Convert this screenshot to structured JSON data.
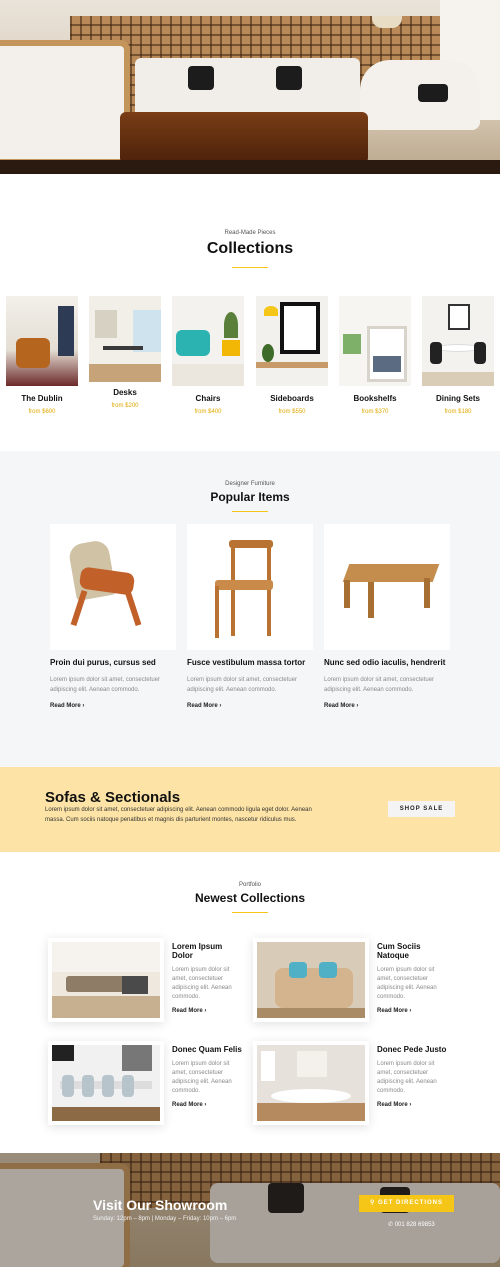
{
  "collections": {
    "eyebrow": "Read-Made Pieces",
    "title": "Collections",
    "items": [
      {
        "name": "The Dublin",
        "price": "from $600"
      },
      {
        "name": "Desks",
        "price": "from $200"
      },
      {
        "name": "Chairs",
        "price": "from $400"
      },
      {
        "name": "Sideboards",
        "price": "from $550"
      },
      {
        "name": "Bookshelfs",
        "price": "from $370"
      },
      {
        "name": "Dining Sets",
        "price": "from $180"
      }
    ]
  },
  "popular": {
    "eyebrow": "Designer Furniture",
    "title": "Popular Items",
    "items": [
      {
        "title": "Proin dui purus, cursus sed",
        "desc": "Lorem ipsum dolor sit amet, consectetuer adipiscing elit. Aenean commodo.",
        "more": "Read More ›"
      },
      {
        "title": "Fusce vestibulum massa tortor",
        "desc": "Lorem ipsum dolor sit amet, consectetuer adipiscing elit. Aenean commodo.",
        "more": "Read More ›"
      },
      {
        "title": "Nunc sed odio iaculis, hendrerit",
        "desc": "Lorem ipsum dolor sit amet, consectetuer adipiscing elit. Aenean commodo.",
        "more": "Read More ›"
      }
    ]
  },
  "promo": {
    "title": "Sofas & Sectionals",
    "text": "Lorem ipsum dolor sit amet, consectetuer adipiscing elit. Aenean commodo ligula eget dolor. Aenean massa. Cum sociis natoque penatibus et magnis dis parturient montes, nascetur ridiculus mus.",
    "button": "SHOP SALE"
  },
  "newest": {
    "eyebrow": "Portfolio",
    "title": "Newest Collections",
    "items": [
      {
        "title": "Lorem Ipsum Dolor",
        "desc": "Lorem ipsum dolor sit amet, consectetuer adipiscing elit. Aenean commodo.",
        "more": "Read More ›"
      },
      {
        "title": "Cum Sociis Natoque",
        "desc": "Lorem ipsum dolor sit amet, consectetuer adipiscing elit. Aenean commodo.",
        "more": "Read More ›"
      },
      {
        "title": "Donec Quam Felis",
        "desc": "Lorem ipsum dolor sit amet, consectetuer adipiscing elit. Aenean commodo.",
        "more": "Read More ›"
      },
      {
        "title": "Donec Pede Justo",
        "desc": "Lorem ipsum dolor sit amet, consectetuer adipiscing elit. Aenean commodo.",
        "more": "Read More ›"
      }
    ]
  },
  "showroom": {
    "title": "Visit Our Showroom",
    "hours": "Sunday: 12pm – 8pm | Monday – Friday: 10pm – 6pm",
    "button": "GET DIRECTIONS",
    "phone": "001 828 69853"
  },
  "colors": {
    "accent": "#f5c518",
    "promo_bg": "#fde4a6",
    "section_bg": "#f5f6f8"
  }
}
